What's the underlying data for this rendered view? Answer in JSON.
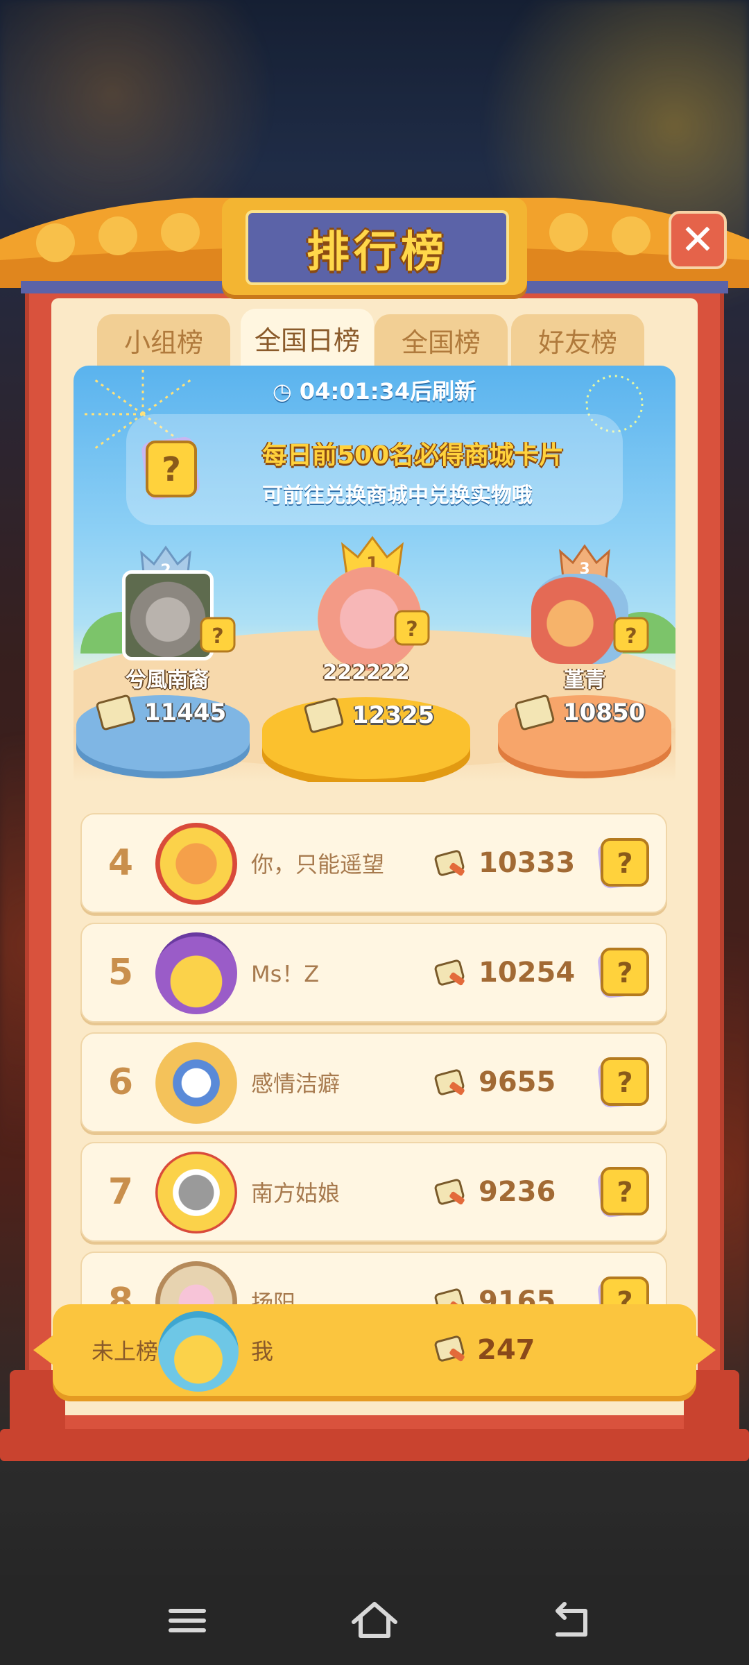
{
  "board": {
    "title": "排行榜",
    "close_glyph": "✕"
  },
  "tabs": [
    {
      "label": "小组榜",
      "active": false
    },
    {
      "label": "全国日榜",
      "active": true
    },
    {
      "label": "全国榜",
      "active": false
    },
    {
      "label": "好友榜",
      "active": false
    }
  ],
  "hero": {
    "refresh_text": "04:01:34后刷新",
    "banner_line1": "每日前500名必得商城卡片",
    "banner_line2": "可前往兑换商城中兑换实物哦"
  },
  "podium": {
    "first": {
      "rank": "1",
      "name": "222222",
      "score": "12325"
    },
    "second": {
      "rank": "2",
      "name": "兮風南裔",
      "score": "11445"
    },
    "third": {
      "rank": "3",
      "name": "堇青",
      "score": "10850"
    }
  },
  "ranking": [
    {
      "rank": "4",
      "name": "你，只能遥望",
      "score": "10333"
    },
    {
      "rank": "5",
      "name": "Ms！Z",
      "score": "10254"
    },
    {
      "rank": "6",
      "name": "感情洁癖",
      "score": "9655"
    },
    {
      "rank": "7",
      "name": "南方姑娘",
      "score": "9236"
    },
    {
      "rank": "8",
      "name": "扬阳",
      "score": "9165"
    }
  ],
  "me": {
    "status": "未上榜",
    "name": "我",
    "score": "247"
  },
  "colors": {
    "frame": "#d9523d",
    "parchment": "#fbe9c7",
    "gold": "#fbc53e",
    "plaque_blue": "#5b63a8"
  },
  "icons": {
    "score": "scroll-brush-icon",
    "card": "mystery-card-icon",
    "refresh": "clock-icon"
  }
}
